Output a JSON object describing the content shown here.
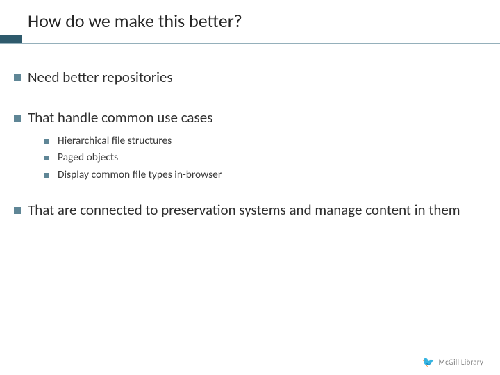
{
  "title": "How do we make this better?",
  "bullets": [
    {
      "text": "Need better repositories",
      "sub": []
    },
    {
      "text": "That handle common use cases",
      "sub": [
        "Hierarchical file structures",
        "Paged objects",
        "Display common file types in-browser"
      ]
    },
    {
      "text": "That are connected to preservation systems and manage content in them",
      "sub": []
    }
  ],
  "footer": {
    "icon": "🐦",
    "label": "McGill Library"
  },
  "colors": {
    "accent": "#5f8696",
    "accent_dark": "#2e5a6c",
    "rule": "#95b0bb"
  }
}
